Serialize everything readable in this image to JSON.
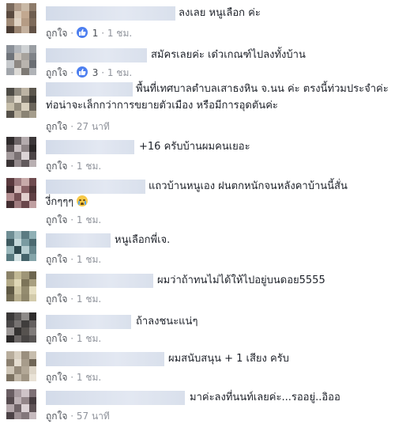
{
  "like_label": "ถูกใจ",
  "separator": "·",
  "colors": {
    "link": "#4b4f56",
    "meta": "#90949c",
    "like_badge": "#4d7ff0"
  },
  "comments": [
    {
      "text": "ลงเลย หนูเลือก ค่ะ",
      "likes": "1",
      "time": "1 ชม."
    },
    {
      "text": "สมัครเลยค่ะ เด๋วเกณฑ์ไปลงทั้งบ้าน",
      "likes": "3",
      "time": "1 ชม."
    },
    {
      "text_line1": "พื้นที่เทศบาลตำบลเสาธงหิน จ.นน ค่ะ ตรงนี้ท่วมประจำค่ะ",
      "text_line2": "ท่อน่าจะเล็กกว่าการขยายตัวเมือง หรือมีการอุดตันค่ะ",
      "time": "27 นาที"
    },
    {
      "text": "+16 ครับบ้านผมคนเยอะ",
      "time": "1 ชม."
    },
    {
      "text_line1": "แถวบ้านหนูเอง ฝนตกหนักจนหลังคาบ้านนี้สั่น",
      "text_line2": "งี่กๆๆๆ",
      "emoji": "crying-face-icon",
      "time": "1 ชม."
    },
    {
      "text": "หนูเลือกพี่เจ.",
      "time": "1 ชม."
    },
    {
      "text": "ผมว่าถ้าทนไม่ได้ให้ไปอยู่บนดอย5555",
      "time": "1 ชม."
    },
    {
      "text": "ถ้าลงชนะแน่ๆ",
      "time": "1 ชม."
    },
    {
      "text": "ผมสนับสนุน + 1 เสียง ครับ",
      "time": "1 ชม."
    },
    {
      "text": "มาค่ะลงที่นนท์เลยค่ะ...รออยู่..อิออ",
      "time": "57 นาที"
    }
  ]
}
